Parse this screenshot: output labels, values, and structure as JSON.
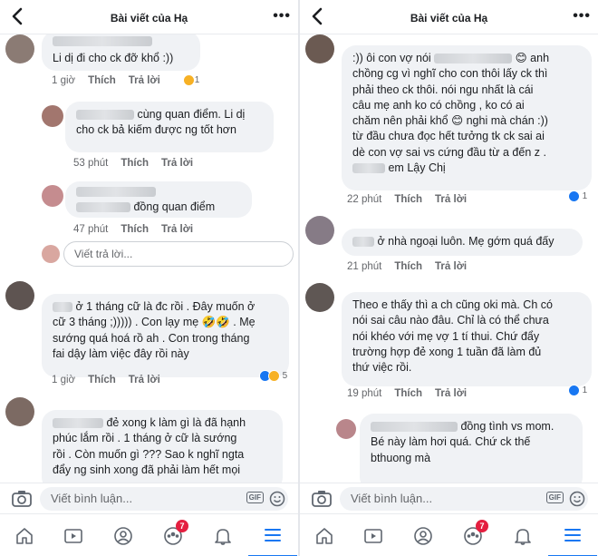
{
  "left": {
    "header": {
      "title": "Bài viết của Hạ"
    },
    "comments": [
      {
        "text": "Li dị đi cho ck đỡ khổ :))",
        "time": "1 giờ",
        "like": "Thích",
        "reply": "Trả lời",
        "reactions": "1"
      },
      {
        "text_pre": "cùng quan điểm. Li dị",
        "text_rest": "cho ck bả kiếm được ng tốt hơn",
        "time": "53 phút",
        "like": "Thích",
        "reply": "Trả lời"
      },
      {
        "text": "đồng quan điểm",
        "time": "47 phút",
        "like": "Thích",
        "reply": "Trả lời"
      },
      {
        "l1": "ở 1 tháng cữ là đc rồi . Đây muốn ở",
        "l2": "cữ 3 tháng ;))))) . Con lạy mẹ 🤣🤣 . Mẹ",
        "l3": "sướng quá hoá rồ ah . Con trong tháng",
        "l4": "fai dậy làm việc đây rồi này",
        "time": "1 giờ",
        "like": "Thích",
        "reply": "Trả lời",
        "reactions": "5"
      },
      {
        "l1": "đẻ xong k làm gì là đã hạnh",
        "l2": "phúc lắm rồi . 1 tháng ở cữ là sướng",
        "l3": "rồi . Còn muốn gì ??? Sao k nghĩ ngta",
        "l4": "đẩy ng sinh xong đã phải làm hết mọi"
      }
    ],
    "reply_placeholder": "Viết trả lời...",
    "composer_placeholder": "Viết bình luận...",
    "gif_label": "GIF",
    "badge": "7"
  },
  "right": {
    "header": {
      "title": "Bài viết của Hạ"
    },
    "comments": [
      {
        "l1a": ":)) ôi con vợ nói",
        "l1b": "😊 anh",
        "l2": "chồng cg vì nghĩ cho con thôi lấy ck thì",
        "l3": "phải theo ck thôi.  nói ngu nhất là cái",
        "l4": "câu mẹ anh ko có chồng , ko có ai",
        "l5": "chăm nên phải khổ 😊 nghi mà chán :))",
        "l6": "từ đầu chưa đọc hết tưởng tk ck sai ai",
        "l7": "dè con vợ sai vs cứng đầu từ a đến z .",
        "l8": "em Lậy Chị",
        "time": "22 phút",
        "like": "Thích",
        "reply": "Trả lời",
        "reactions": "1"
      },
      {
        "text": "ở nhà ngoại luôn. Mẹ gớm quá đấy",
        "time": "21 phút",
        "like": "Thích",
        "reply": "Trả lời"
      },
      {
        "l1": "Theo e thấy thì a ch cũng oki mà. Ch có",
        "l2": "nói sai câu nào đâu. Chỉ là có thể chưa",
        "l3": "nói khéo với mẹ vợ 1 tí thui. Chứ đẩy",
        "l4": "trường hợp đẻ xong 1 tuần đã làm đủ",
        "l5": "thứ việc rồi.",
        "time": "19 phút",
        "like": "Thích",
        "reply": "Trả lời",
        "reactions": "1"
      },
      {
        "l1": "đồng tình vs mom.",
        "l2": "Bé này làm hơi quá. Chứ ck thế",
        "l3": "bthuong mà"
      }
    ],
    "composer_placeholder": "Viết bình luận...",
    "gif_label": "GIF",
    "badge": "7"
  }
}
